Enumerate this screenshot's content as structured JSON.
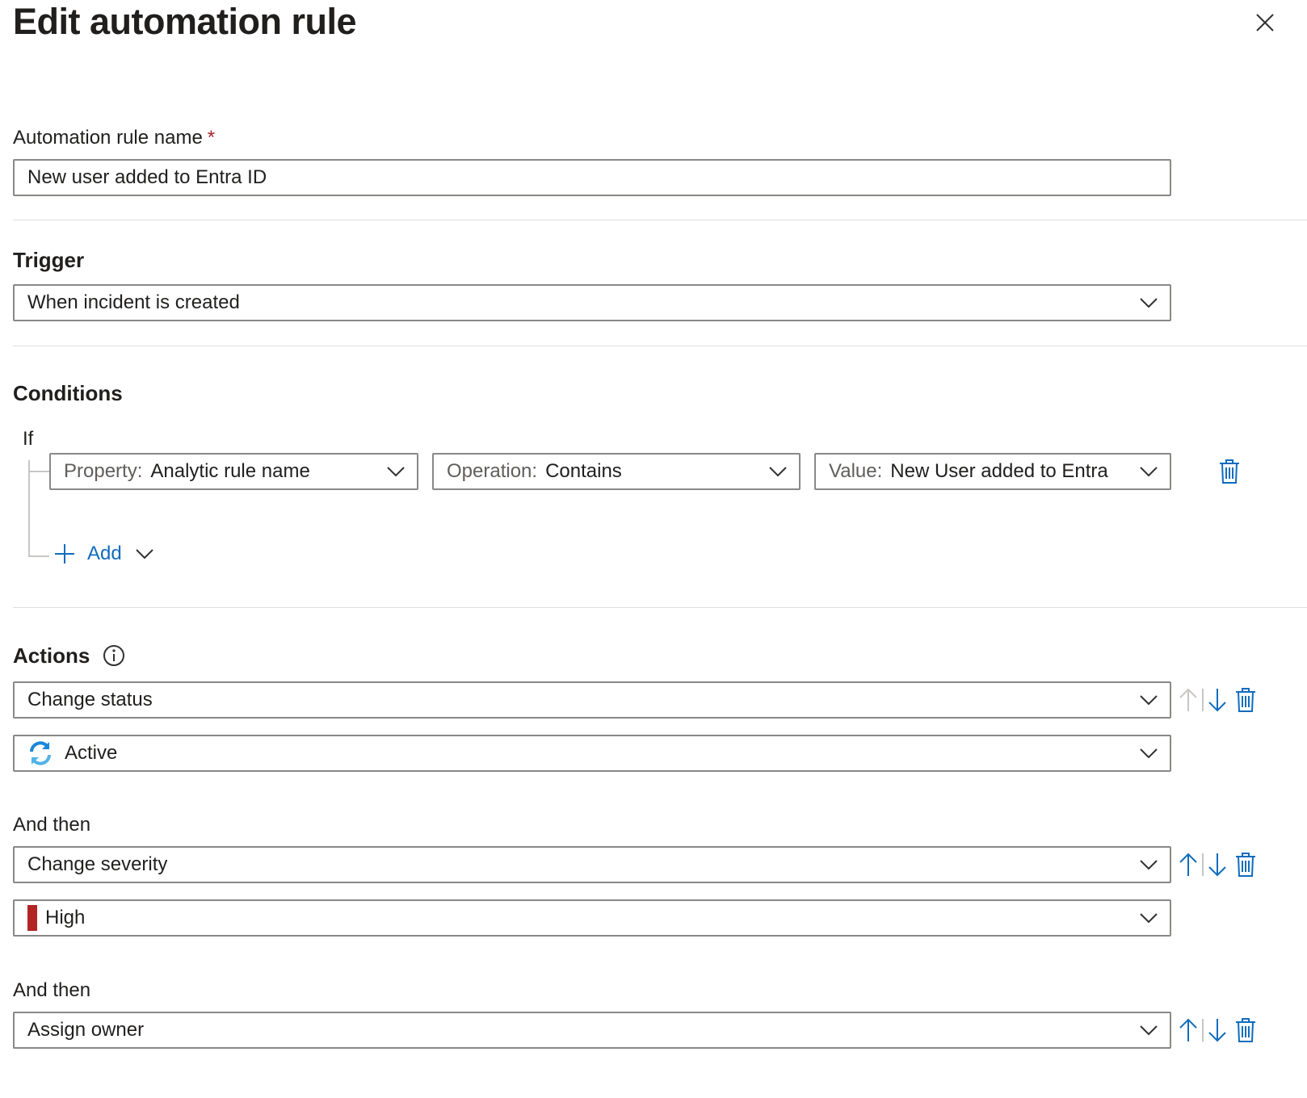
{
  "header": {
    "title": "Edit automation rule",
    "close_icon": "close-icon"
  },
  "name_field": {
    "label": "Automation rule name",
    "required_marker": "*",
    "value": "New user added to Entra ID"
  },
  "trigger": {
    "heading": "Trigger",
    "value": "When incident is created"
  },
  "conditions": {
    "heading": "Conditions",
    "if_label": "If",
    "row": {
      "property_key": "Property:",
      "property_value": "Analytic rule name",
      "operation_key": "Operation:",
      "operation_value": "Contains",
      "value_key": "Value:",
      "value_value": "New User added to Entra"
    },
    "add_label": "Add"
  },
  "actions": {
    "heading": "Actions",
    "and_then_label": "And then",
    "items": [
      {
        "action": "Change status",
        "sub_value": "Active",
        "sub_icon": "refresh-icon"
      },
      {
        "action": "Change severity",
        "sub_value": "High",
        "sub_color": "#b32424"
      },
      {
        "action": "Assign owner"
      }
    ]
  },
  "colors": {
    "accent": "#0f6cbd",
    "severity_high": "#b32424",
    "border": "#8a8886"
  }
}
